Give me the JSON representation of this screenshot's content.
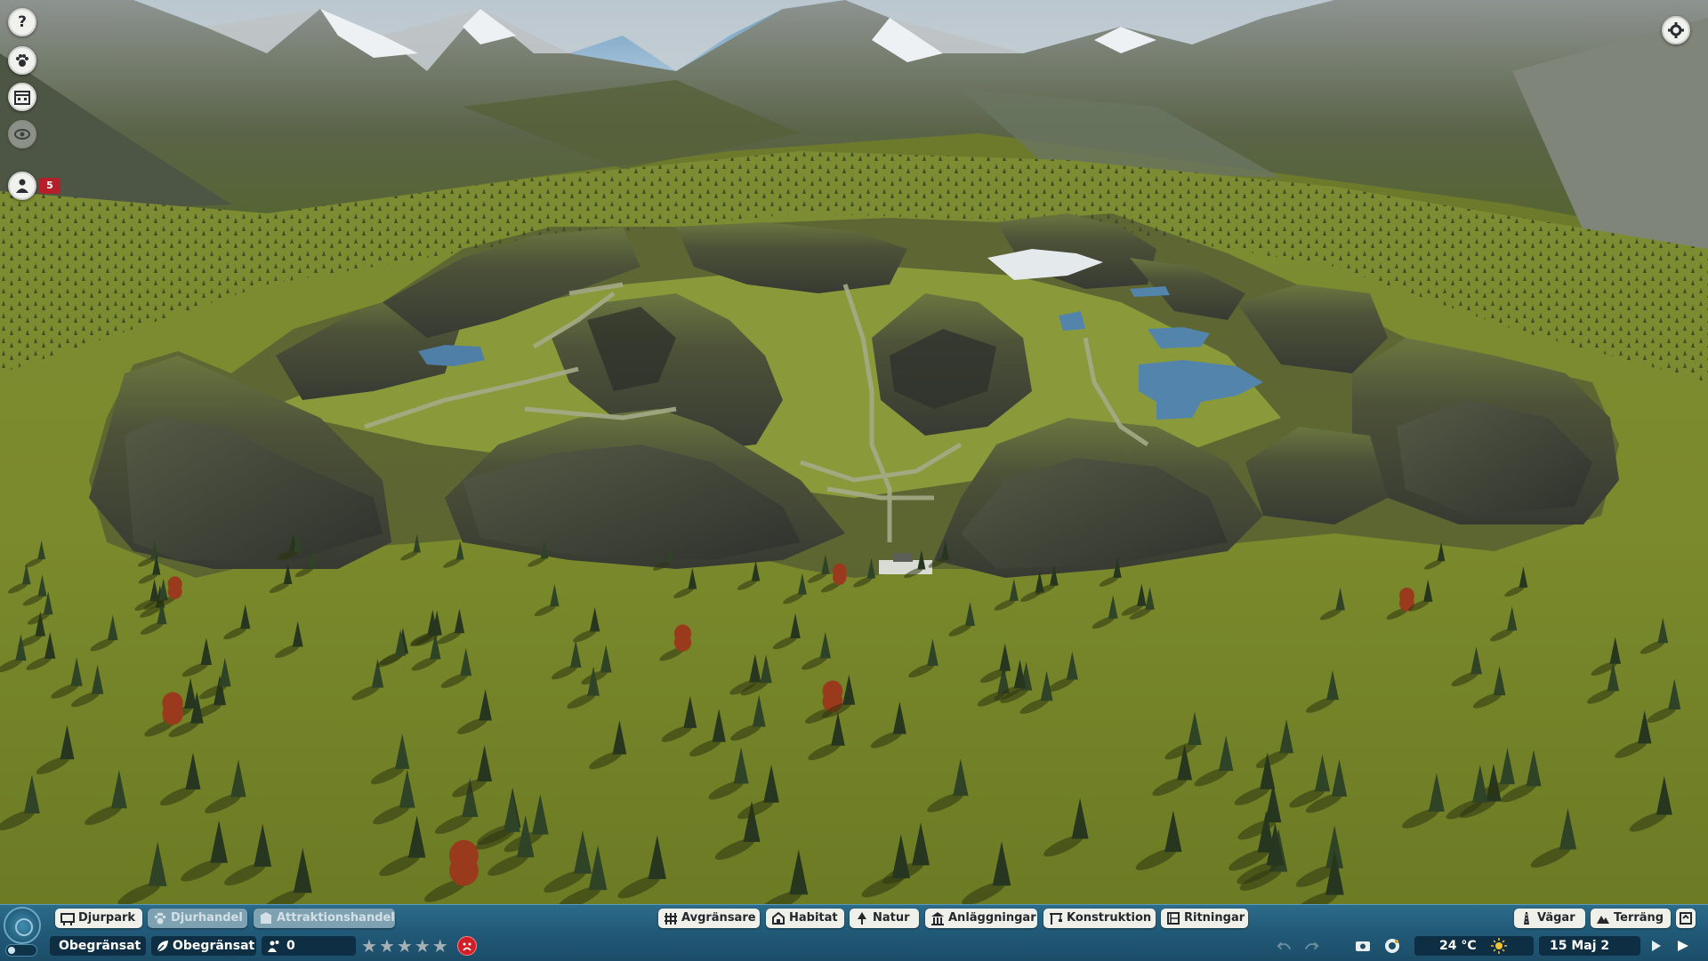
{
  "side_menu": {
    "help_label": "?",
    "guest_count": "5",
    "icons": [
      "help-icon",
      "animal-paw-icon",
      "calendar-icon",
      "eye-view-icon",
      "guest-person-icon"
    ]
  },
  "bottom_tabs": {
    "left": [
      {
        "label": "Djurpark",
        "icon": "zoo-sign-icon",
        "enabled": true
      },
      {
        "label": "Djurhandel",
        "icon": "paw-icon",
        "enabled": false
      },
      {
        "label": "Attraktionshandel",
        "icon": "attraction-icon",
        "enabled": false
      }
    ],
    "center": [
      {
        "label": "Avgränsare",
        "icon": "fence-icon"
      },
      {
        "label": "Habitat",
        "icon": "habitat-icon"
      },
      {
        "label": "Natur",
        "icon": "tree-icon"
      },
      {
        "label": "Anläggningar",
        "icon": "facility-icon"
      },
      {
        "label": "Konstruktion",
        "icon": "construction-icon"
      },
      {
        "label": "Ritningar",
        "icon": "blueprint-icon"
      }
    ],
    "right": [
      {
        "label": "Vägar",
        "icon": "path-icon"
      },
      {
        "label": "Terräng",
        "icon": "terrain-icon"
      }
    ]
  },
  "status_bar": {
    "money": "Obegränsat",
    "research": "Obegränsat",
    "guests": "0",
    "rating_stars": 0,
    "rating_max": 5,
    "temperature": "24 °C",
    "weather_icon": "sun-icon",
    "date": "15 Maj 2"
  },
  "colors": {
    "bar_top": "#2c6b8a",
    "bar_bottom": "#1c4d68",
    "tab_bg": "#f0f0ea",
    "tab_disabled_bg": "#7fa2b3",
    "mood_red": "#d01f28",
    "badge_red": "#b3202a",
    "grass": "#6d7a2c"
  }
}
